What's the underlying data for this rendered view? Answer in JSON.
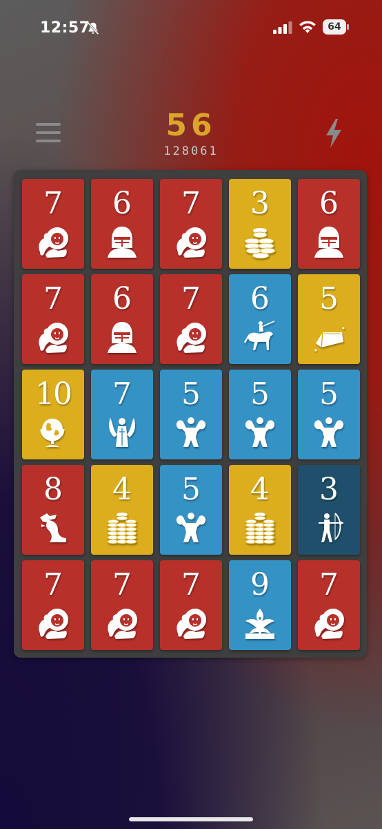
{
  "status_bar": {
    "time": "12:57",
    "battery": "64"
  },
  "header": {
    "score": "56",
    "best_score": "128061"
  },
  "colors": {
    "red": "#b8302a",
    "yellow": "#dcae1d",
    "blue": "#3592c5",
    "navy": "#1f4f6b",
    "score": "#d9a52a"
  },
  "board": {
    "rows": [
      [
        {
          "value": "7",
          "color": "red",
          "icon": "lion-icon"
        },
        {
          "value": "6",
          "color": "red",
          "icon": "knight-helmet-icon"
        },
        {
          "value": "7",
          "color": "red",
          "icon": "lion-icon"
        },
        {
          "value": "3",
          "color": "yellow",
          "icon": "coins-icon"
        },
        {
          "value": "6",
          "color": "red",
          "icon": "knight-helmet-icon"
        }
      ],
      [
        {
          "value": "7",
          "color": "red",
          "icon": "lion-icon"
        },
        {
          "value": "6",
          "color": "red",
          "icon": "knight-helmet-icon"
        },
        {
          "value": "7",
          "color": "red",
          "icon": "lion-icon"
        },
        {
          "value": "6",
          "color": "blue",
          "icon": "cavalry-icon"
        },
        {
          "value": "5",
          "color": "yellow",
          "icon": "gold-bar-icon"
        }
      ],
      [
        {
          "value": "10",
          "color": "yellow",
          "icon": "globe-icon"
        },
        {
          "value": "7",
          "color": "blue",
          "icon": "angel-icon"
        },
        {
          "value": "5",
          "color": "blue",
          "icon": "strongman-icon"
        },
        {
          "value": "5",
          "color": "blue",
          "icon": "strongman-icon"
        },
        {
          "value": "5",
          "color": "blue",
          "icon": "strongman-icon"
        }
      ],
      [
        {
          "value": "8",
          "color": "red",
          "icon": "dragon-icon"
        },
        {
          "value": "4",
          "color": "yellow",
          "icon": "coin-stacks-icon"
        },
        {
          "value": "5",
          "color": "blue",
          "icon": "strongman-icon"
        },
        {
          "value": "4",
          "color": "yellow",
          "icon": "coin-stacks-icon"
        },
        {
          "value": "3",
          "color": "navy",
          "icon": "archer-icon"
        }
      ],
      [
        {
          "value": "7",
          "color": "red",
          "icon": "lion-icon"
        },
        {
          "value": "7",
          "color": "red",
          "icon": "lion-icon"
        },
        {
          "value": "7",
          "color": "red",
          "icon": "lion-icon"
        },
        {
          "value": "9",
          "color": "blue",
          "icon": "phoenix-icon"
        },
        {
          "value": "7",
          "color": "red",
          "icon": "lion-icon"
        }
      ]
    ]
  }
}
